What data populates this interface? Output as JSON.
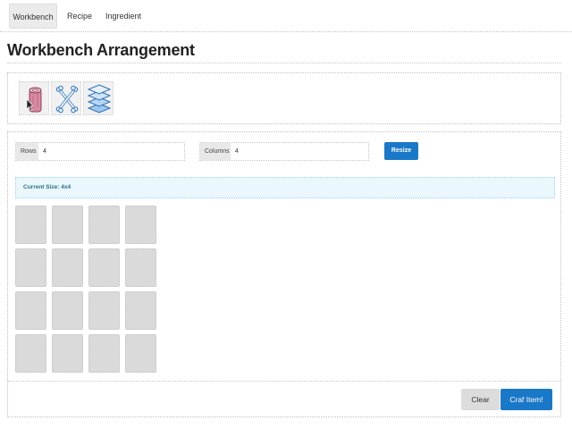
{
  "nav": {
    "tabs": [
      {
        "label": "Workbench",
        "active": true
      },
      {
        "label": "Recipe",
        "active": false
      },
      {
        "label": "Ingredient",
        "active": false
      }
    ]
  },
  "page": {
    "title": "Workbench Arrangement"
  },
  "palette": {
    "items": [
      {
        "icon": "wood-log-icon"
      },
      {
        "icon": "crossed-bones-icon"
      },
      {
        "icon": "stacked-layers-icon"
      }
    ]
  },
  "controls": {
    "rows_label": "Rows",
    "rows_value": "4",
    "columns_label": "Columns",
    "columns_value": "4",
    "resize_label": "Resize"
  },
  "status": {
    "current_size": "Current Size: 4x4"
  },
  "grid": {
    "rows": 4,
    "columns": 4
  },
  "footer": {
    "clear_label": "Clear",
    "craft_label": "Craf Item!"
  },
  "colors": {
    "primary": "#1a78c9",
    "cell": "#dadada",
    "alert_bg": "#eaf7fd",
    "alert_text": "#2b6f8c"
  }
}
